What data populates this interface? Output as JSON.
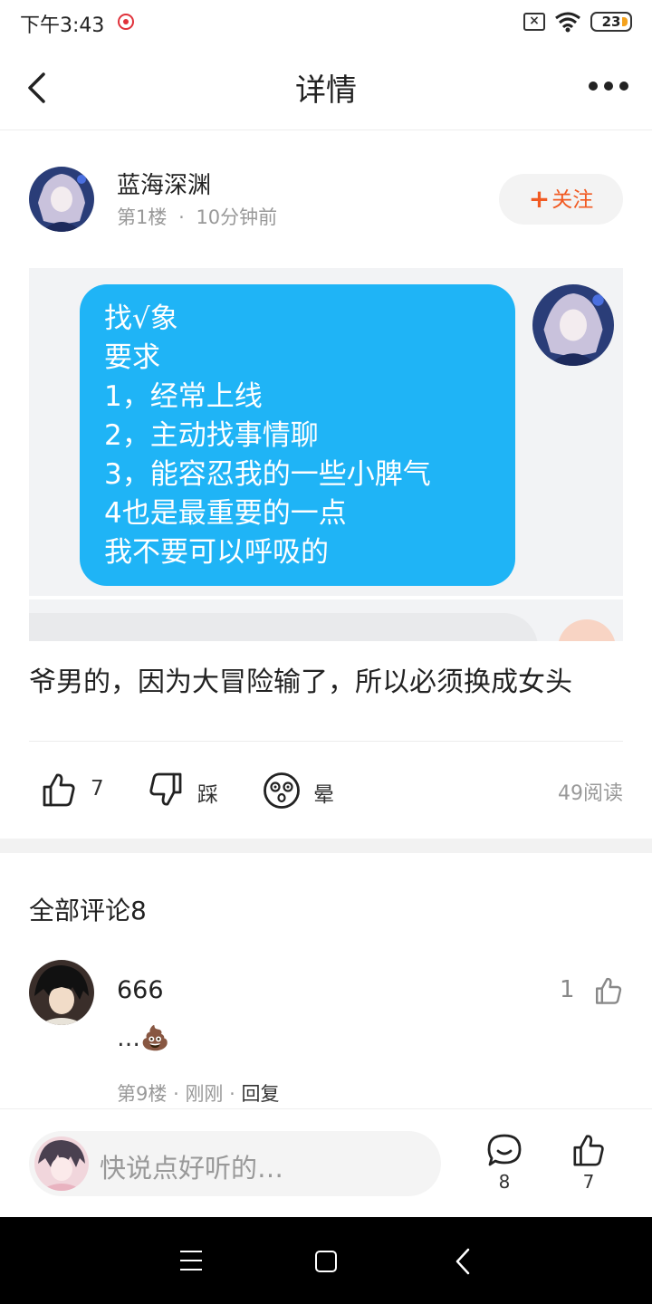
{
  "status_bar": {
    "time": "下午3:43",
    "battery": "23",
    "icons": [
      "record-icon",
      "sim-off-icon",
      "wifi-icon",
      "battery-icon"
    ]
  },
  "header": {
    "title": "详情",
    "back_icon": "chevron-left-icon",
    "more_icon": "more-dots-icon"
  },
  "post": {
    "author": "蓝海深渊",
    "floor": "第1楼",
    "separator": "·",
    "time": "10分钟前",
    "follow_label": "关注",
    "follow_plus": "+",
    "image_chat_lines": [
      "找√象",
      "要求",
      "1，经常上线",
      "2，主动找事情聊",
      "3，能容忍我的一些小脾气",
      "4也是最重要的一点",
      "我不要可以呼吸的"
    ],
    "text": "爷男的，因为大冒险输了，所以必须换成女头",
    "likes": "7",
    "dislike_label": "踩",
    "dizzy_label": "晕",
    "reads": "49阅读"
  },
  "comments": {
    "heading": "全部评论8",
    "items": [
      {
        "user": "666",
        "like_count": "1",
        "text": "…💩",
        "floor": "第9楼",
        "time": "刚刚",
        "separator": "·",
        "reply_label": "回复"
      }
    ]
  },
  "bottom_bar": {
    "placeholder": "快说点好听的…",
    "comment_count": "8",
    "like_count": "7"
  },
  "colors": {
    "accent": "#f15a22",
    "bubble": "#1fb4f6",
    "muted": "#999999"
  }
}
